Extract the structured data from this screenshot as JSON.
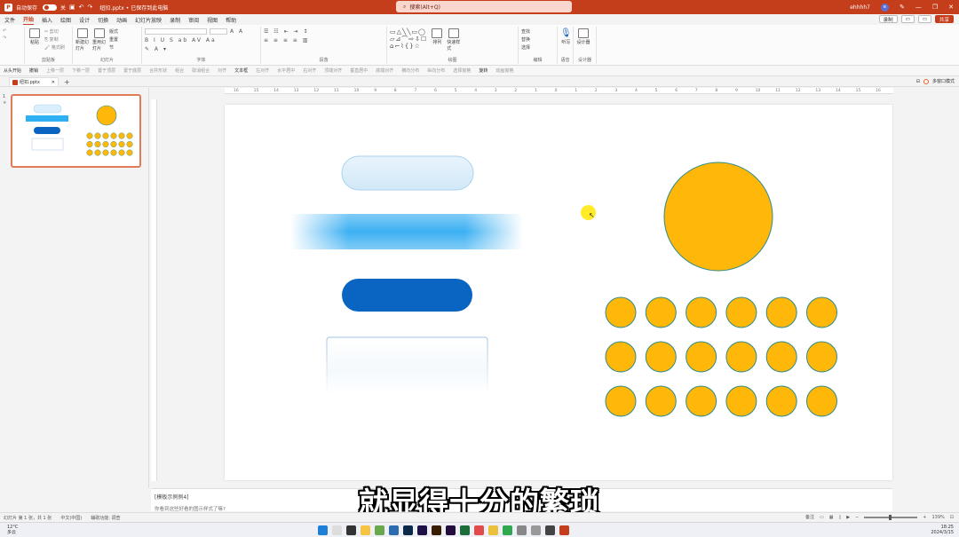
{
  "titlebar": {
    "autosave_label": "自动保存",
    "toggle_state": "关",
    "filename": "纽扣.pptx • 已保存到此电脑",
    "search_placeholder": "搜索(Alt+Q)",
    "user_name": "ehhhh7"
  },
  "menu": {
    "items": [
      "文件",
      "开始",
      "插入",
      "绘图",
      "设计",
      "切换",
      "动画",
      "幻灯片放映",
      "录制",
      "审阅",
      "视图",
      "帮助"
    ],
    "active": "开始",
    "record_label": "录制",
    "share_label": "共享"
  },
  "ribbon": {
    "groups": {
      "clipboard": "剪贴板",
      "slides": "幻灯片",
      "font": "字体",
      "paragraph": "段落",
      "drawing": "绘图",
      "editing": "编辑",
      "voice": "语音",
      "designer": "设计器"
    },
    "buttons": {
      "paste": "粘贴",
      "new_slide": "新建幻灯片",
      "reuse_slide": "重用幻灯片",
      "layout": "版式",
      "reset": "重置",
      "section": "节",
      "arrange": "排列",
      "quick_styles": "快速样式",
      "find": "查找",
      "replace": "替换",
      "select": "选择",
      "dictate": "听写",
      "designer": "设计器"
    }
  },
  "quickbar": {
    "items": [
      "从头开始",
      "撤销",
      "上移一层",
      "下移一层",
      "置于顶层",
      "置于底层",
      "合并形状",
      "组合",
      "取消组合",
      "对齐",
      "文本框",
      "左对齐",
      "水平居中",
      "右对齐",
      "顶端对齐",
      "垂直居中",
      "底端对齐",
      "横向分布",
      "纵向分布",
      "选择窗格",
      "旋转",
      "动画窗格",
      "上移一层",
      "置于顶层"
    ],
    "enabled": [
      0,
      1,
      10,
      25
    ]
  },
  "tabs": {
    "file_tab": "纽扣.pptx",
    "multi_window": "多窗口模式"
  },
  "ruler": {
    "ticks": [
      "16",
      "15",
      "14",
      "13",
      "12",
      "11",
      "10",
      "9",
      "8",
      "7",
      "6",
      "5",
      "4",
      "3",
      "2",
      "1",
      "0",
      "1",
      "2",
      "3",
      "4",
      "5",
      "6",
      "7",
      "8",
      "9",
      "10",
      "11",
      "12",
      "13",
      "14",
      "15",
      "16"
    ]
  },
  "thumbnail": {
    "number": "1",
    "star": "★"
  },
  "notes": {
    "title": "[模板示例例4]",
    "hint": "你看到这些好看的图示样式了嘛?"
  },
  "caption": "就显得十分的繁琐",
  "status": {
    "slide_info": "幻灯片 第 1 张，共 1 张",
    "language": "中文(中国)",
    "accessibility": "辅助功能: 调查",
    "notes_label": "备注",
    "zoom": "139%"
  },
  "taskbar": {
    "temperature": "12°C",
    "weather": "多云",
    "time": "18:25",
    "date": "2024/3/15"
  },
  "colors": {
    "accent": "#c43e1c",
    "circle_fill": "#ffb80a",
    "circle_stroke": "#2d8a8a",
    "dark_blue": "#0a64c2",
    "bright_blue": "#1aa2f0"
  }
}
